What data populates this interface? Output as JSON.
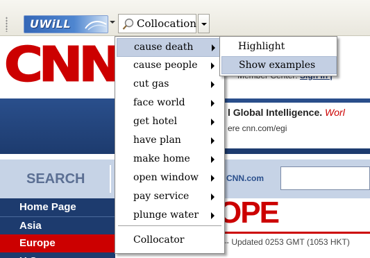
{
  "toolbar": {
    "brand_label": "UWiLL",
    "collocation_label": "Collocation"
  },
  "site": {
    "logo_text": "CNN",
    "member_center_text": "Member Center:",
    "member_center_link": "Sign In |",
    "promo_headline": "l Global Intelligence.",
    "promo_headline_tail": "Worl",
    "promo_sub": "ere cnn.com/egi",
    "search_label": "SEARCH",
    "cnncom_label": "CNN.com",
    "nav": [
      "Home Page",
      "Asia",
      "Europe",
      "U.S."
    ],
    "section_heading": "OPE",
    "updated_text": "-- Updated 0253 GMT (1053 HKT)"
  },
  "menu": {
    "items": [
      {
        "label": "cause death",
        "has_submenu": true,
        "selected": true
      },
      {
        "label": "cause people",
        "has_submenu": true
      },
      {
        "label": "cut gas",
        "has_submenu": true
      },
      {
        "label": "face world",
        "has_submenu": true
      },
      {
        "label": "get hotel",
        "has_submenu": true
      },
      {
        "label": "have plan",
        "has_submenu": true
      },
      {
        "label": "make home",
        "has_submenu": true
      },
      {
        "label": "open window",
        "has_submenu": true
      },
      {
        "label": "pay service",
        "has_submenu": true
      },
      {
        "label": "plunge water",
        "has_submenu": true
      }
    ],
    "footer_item": "Collocator"
  },
  "submenu": {
    "items": [
      {
        "label": "Highlight"
      },
      {
        "label": "Show examples",
        "selected": true
      }
    ]
  },
  "colors": {
    "selection": "#c3cfe3",
    "cnn_red": "#cc0000",
    "navy": "#1d3b6e"
  }
}
